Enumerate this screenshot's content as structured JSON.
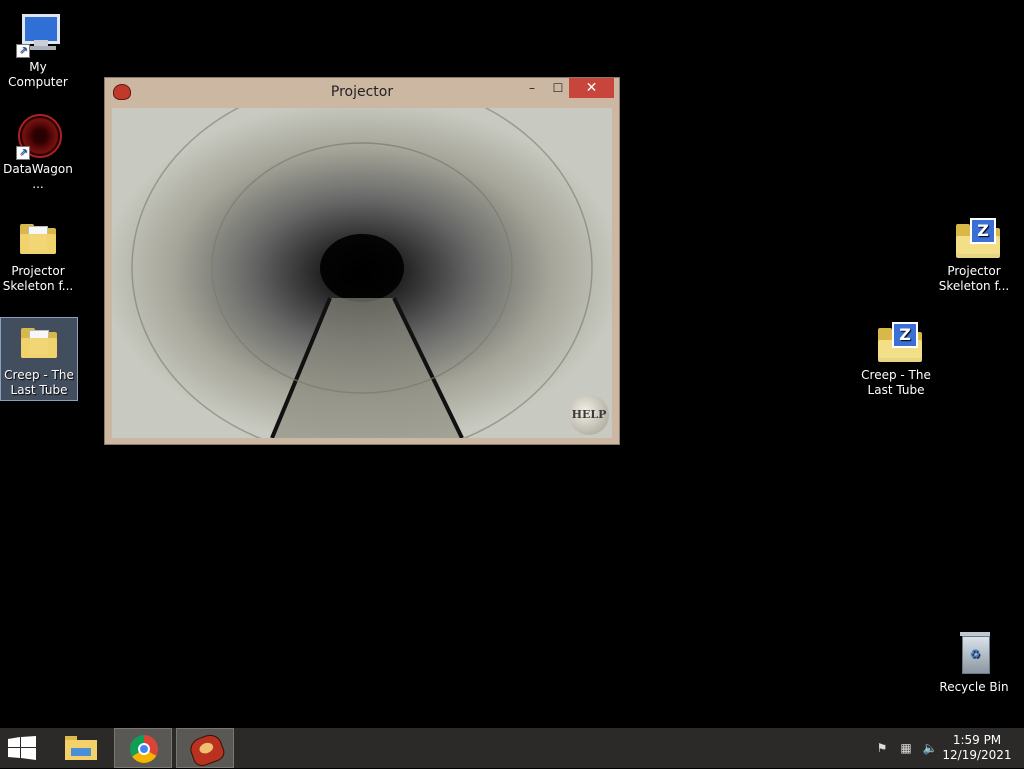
{
  "desktop": {
    "left_icons": [
      {
        "label": "My Computer"
      },
      {
        "label": "DataWagon..."
      },
      {
        "label": "Projector Skeleton f..."
      },
      {
        "label": "Creep - The Last Tube"
      }
    ],
    "right_icons": [
      {
        "label": "Projector Skeleton f..."
      },
      {
        "label": "Creep - The Last Tube"
      },
      {
        "label": "Recycle Bin"
      }
    ]
  },
  "window": {
    "title": "Projector",
    "minimize_glyph": "–",
    "maximize_glyph": "☐",
    "close_glyph": "✕",
    "help_label": "HELP"
  },
  "taskbar": {
    "start_icon": "windows-logo-icon",
    "pinned": [
      "file-explorer-icon",
      "chrome-icon",
      "projector-app-icon"
    ],
    "tray": {
      "time": "1:59 PM",
      "date": "12/19/2021"
    }
  },
  "colors": {
    "desktop": "#000000",
    "window_frame": "#ccb8a2",
    "close_button": "#c7453a",
    "taskbar": "#2b2a28"
  }
}
